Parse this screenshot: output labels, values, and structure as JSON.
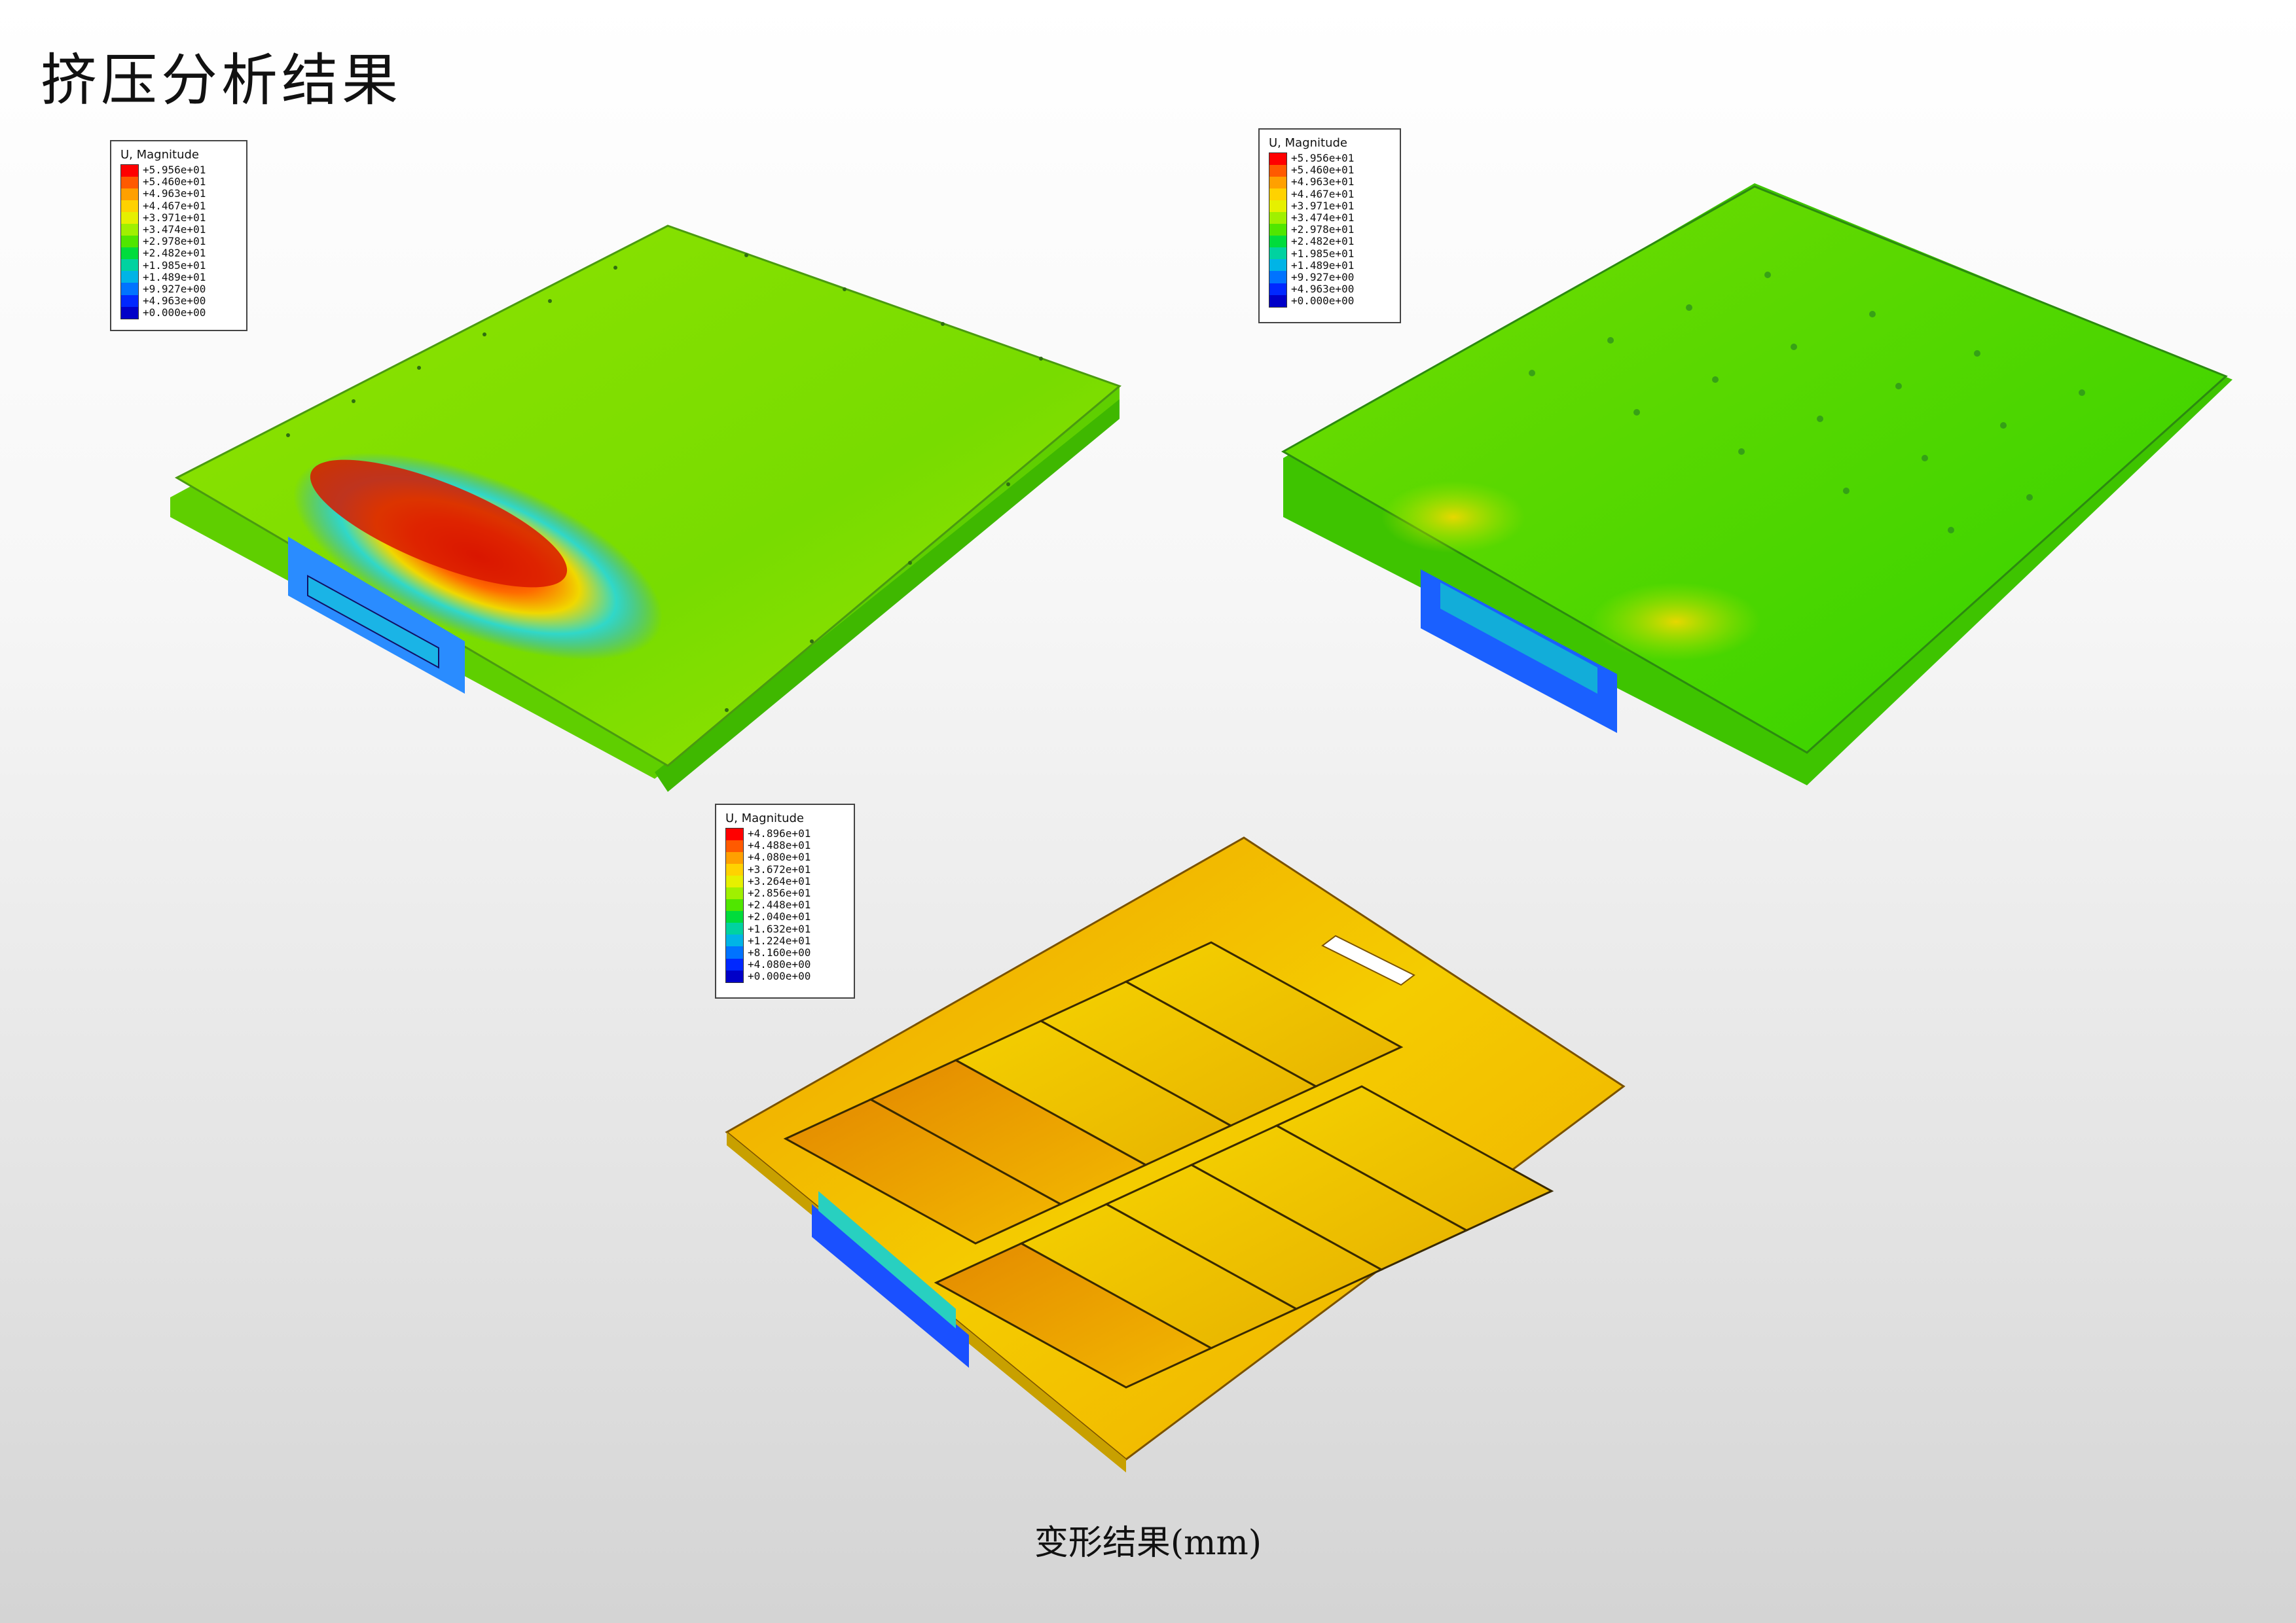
{
  "page": {
    "title": "挤压分析结果",
    "caption": "变形结果(mm)"
  },
  "legends": [
    {
      "title": "U, Magnitude",
      "values": [
        "+5.956e+01",
        "+5.460e+01",
        "+4.963e+01",
        "+4.467e+01",
        "+3.971e+01",
        "+3.474e+01",
        "+2.978e+01",
        "+2.482e+01",
        "+1.985e+01",
        "+1.489e+01",
        "+9.927e+00",
        "+4.963e+00",
        "+0.000e+00"
      ]
    },
    {
      "title": "U, Magnitude",
      "values": [
        "+5.956e+01",
        "+5.460e+01",
        "+4.963e+01",
        "+4.467e+01",
        "+3.971e+01",
        "+3.474e+01",
        "+2.978e+01",
        "+2.482e+01",
        "+1.985e+01",
        "+1.489e+01",
        "+9.927e+00",
        "+4.963e+00",
        "+0.000e+00"
      ]
    },
    {
      "title": "U, Magnitude",
      "values": [
        "+4.896e+01",
        "+4.488e+01",
        "+4.080e+01",
        "+3.672e+01",
        "+3.264e+01",
        "+2.856e+01",
        "+2.448e+01",
        "+2.040e+01",
        "+1.632e+01",
        "+1.224e+01",
        "+8.160e+00",
        "+4.080e+00",
        "+0.000e+00"
      ]
    }
  ],
  "colors": {
    "scale": [
      "#ff0000",
      "#ff5a00",
      "#ffa000",
      "#ffd200",
      "#e6f000",
      "#a0f000",
      "#50e600",
      "#00dc3c",
      "#00d2a0",
      "#00b4e6",
      "#0073ff",
      "#0028ff",
      "#0000c8"
    ]
  }
}
